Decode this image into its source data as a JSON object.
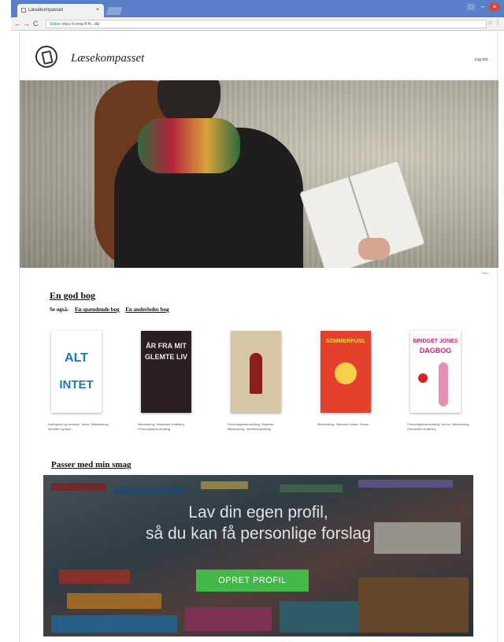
{
  "browser": {
    "tab_title": "Læsekompasset",
    "tab_close": "×",
    "url_prefix": "Sikker",
    "url": "https://comp-ff-fh...dk/",
    "window_controls": [
      "□",
      "–",
      "×"
    ],
    "nav": {
      "back": "←",
      "forward": "→",
      "reload": "C"
    },
    "icons": {
      "star": "star-icon",
      "menu": "menu-icon"
    }
  },
  "header": {
    "brand": "Læsekompasset",
    "login": "Log ind"
  },
  "hero": {
    "credit": "Foto: ..."
  },
  "section1": {
    "title": "En god bog",
    "see_also": "Se også:",
    "link1": "En spændende bog",
    "link2": "En anderledes bog"
  },
  "books": [
    {
      "t1": "ALT",
      "t2": "INTET",
      "desc": "Kærlighed og venskab, Tanke. Mikkelsberg, Identitet og kaos",
      "bg": "#ffffff",
      "fg": "#1c77b9"
    },
    {
      "t1": "ÅR FRA MIT",
      "t2": "GLEMTE LIV",
      "desc": "Mikkelsberg, Historiske fortælling, Personlighedsudvikling",
      "bg": "#2a1d24",
      "fg": "#f0e8e8"
    },
    {
      "t1": "",
      "t2": "",
      "desc": "Personlighedsudvikling, Historisk, Mikkelsberg, Identitetsudvikling",
      "bg": "#d7c6a6",
      "fg": "#8c1d1d"
    },
    {
      "t1": "SOMMERFUGL",
      "t2": "",
      "desc": "Mikkelsberg, Historisk roman, Humor",
      "bg": "#e5402b",
      "fg": "#f7d04a"
    },
    {
      "t1": "BRIDGET JONES",
      "t2": "DAGBOG",
      "desc": "Personlighedsudvikling, Humor, Mikkelsberg, Romantisk fortælling",
      "bg": "#ffffff",
      "fg": "#d1237a"
    }
  ],
  "section2": {
    "title": "Passer med min smag"
  },
  "banner": {
    "line1": "Lav din egen profil,",
    "line2": "så du kan få personlige forslag",
    "cta": "OPRET PROFIL"
  },
  "colors": {
    "cta": "#43b749",
    "tabstrip": "#5b7fc7",
    "close": "#d9463f"
  }
}
